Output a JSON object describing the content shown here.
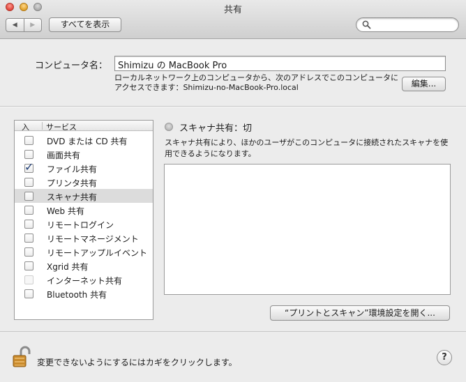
{
  "window": {
    "title": "共有"
  },
  "toolbar": {
    "back_glyph": "◀",
    "forward_glyph": "▶",
    "show_all_label": "すべてを表示",
    "search_placeholder": ""
  },
  "computer_name": {
    "label": "コンピュータ名：",
    "value": "Shimizu の MacBook Pro",
    "description": "ローカルネットワーク上のコンピュータから、次のアドレスでこのコンピュータにアクセスできます：Shimizu-no-MacBook-Pro.local",
    "edit_label": "編集..."
  },
  "services": {
    "header_on": "入",
    "header_service": "サービス",
    "items": [
      {
        "label": "DVD または CD 共有",
        "checked": false,
        "enabled": true,
        "selected": false
      },
      {
        "label": "画面共有",
        "checked": false,
        "enabled": true,
        "selected": false
      },
      {
        "label": "ファイル共有",
        "checked": true,
        "enabled": true,
        "selected": false
      },
      {
        "label": "プリンタ共有",
        "checked": false,
        "enabled": true,
        "selected": false
      },
      {
        "label": "スキャナ共有",
        "checked": false,
        "enabled": true,
        "selected": true
      },
      {
        "label": "Web 共有",
        "checked": false,
        "enabled": true,
        "selected": false
      },
      {
        "label": "リモートログイン",
        "checked": false,
        "enabled": true,
        "selected": false
      },
      {
        "label": "リモートマネージメント",
        "checked": false,
        "enabled": true,
        "selected": false
      },
      {
        "label": "リモートアップルイベント",
        "checked": false,
        "enabled": true,
        "selected": false
      },
      {
        "label": "Xgrid 共有",
        "checked": false,
        "enabled": true,
        "selected": false
      },
      {
        "label": "インターネット共有",
        "checked": false,
        "enabled": false,
        "selected": false
      },
      {
        "label": "Bluetooth 共有",
        "checked": false,
        "enabled": true,
        "selected": false
      }
    ]
  },
  "detail": {
    "status": "スキャナ共有：切",
    "description": "スキャナ共有により、ほかのユーザがこのコンピュータに接続されたスキャナを使用できるようになります。",
    "open_prefs_label": "“プリントとスキャン”環境設定を開く..."
  },
  "footer": {
    "lock_text": "変更できないようにするにはカギをクリックします。",
    "help_glyph": "?"
  },
  "icons": {
    "lock": "lock-open-icon",
    "search": "search-icon",
    "help": "help-icon"
  },
  "colors": {
    "check": "#1d3b73",
    "selection": "#dcdcdc"
  }
}
